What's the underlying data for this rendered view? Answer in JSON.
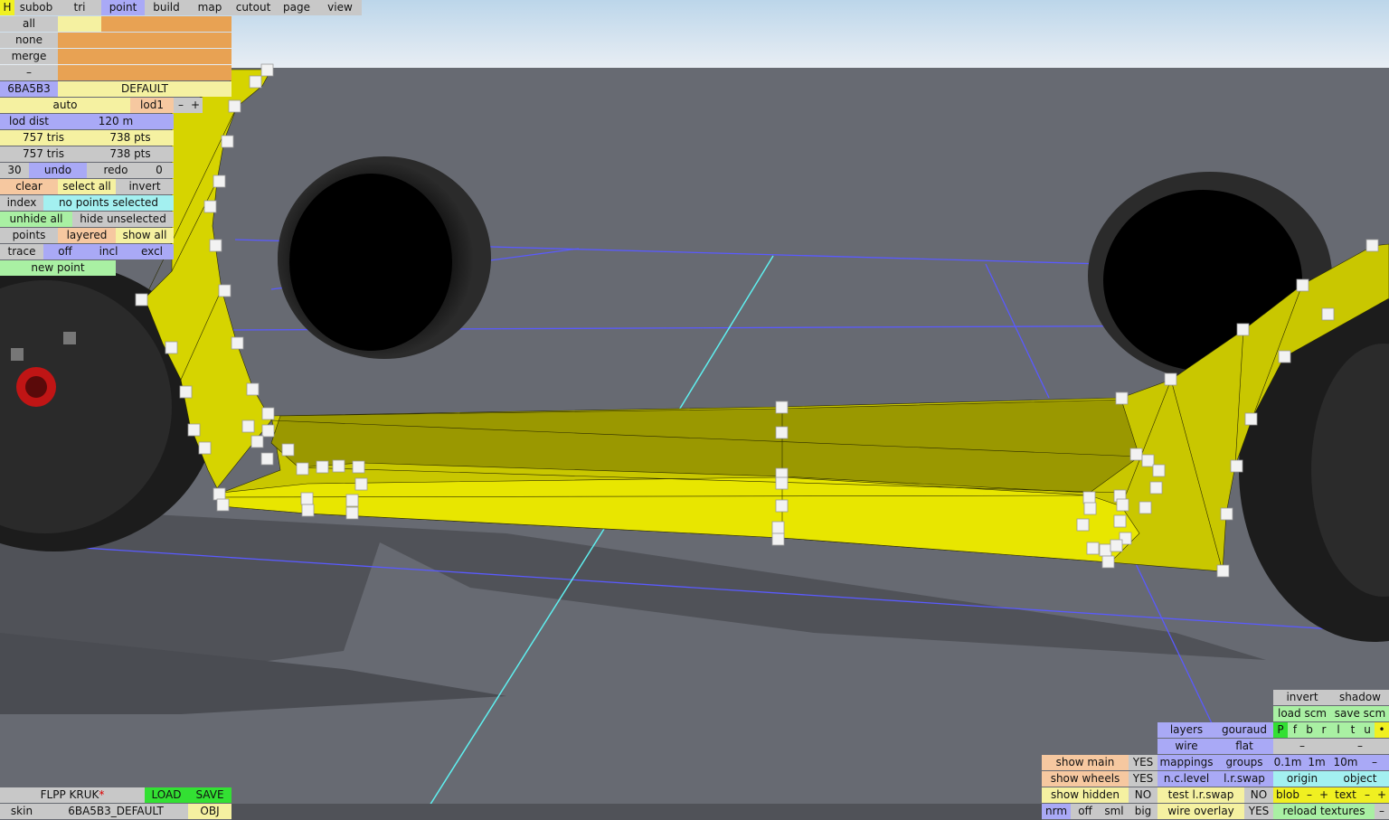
{
  "mode_tabs": [
    {
      "label": "H"
    },
    {
      "label": "subob"
    },
    {
      "label": "tri"
    },
    {
      "label": "point",
      "active": true
    },
    {
      "label": "build"
    },
    {
      "label": "map"
    },
    {
      "label": "cutout"
    },
    {
      "label": "page"
    },
    {
      "label": "view"
    }
  ],
  "selection": {
    "all": "all",
    "none": "none",
    "merge": "merge",
    "dash": "–"
  },
  "object": {
    "id": "6BA5B3",
    "group": "DEFAULT"
  },
  "lod": {
    "auto": "auto",
    "current": "lod1",
    "minus": "–",
    "plus": "+",
    "dist_label": "lod dist",
    "dist_value": "120 m"
  },
  "stats": {
    "tris_total": "757 tris",
    "pts_total": "738 pts",
    "tris_visible": "757 tris",
    "pts_visible": "738 pts"
  },
  "history": {
    "count": "30",
    "undo": "undo",
    "redo": "redo",
    "redo_count": "0"
  },
  "actions": {
    "clear": "clear",
    "select_all": "select all",
    "invert": "invert"
  },
  "index": {
    "label": "index",
    "status": "no points selected"
  },
  "hide": {
    "unhide_all": "unhide all",
    "hide_unselected": "hide unselected"
  },
  "display": {
    "points": "points",
    "layered": "layered",
    "show_all": "show all"
  },
  "trace": {
    "label": "trace",
    "off": "off",
    "incl": "incl",
    "excl": "excl"
  },
  "new_point": "new point",
  "file": {
    "name": "FLPP KRUK",
    "modified_mark": "*",
    "load": "LOAD",
    "save": "SAVE",
    "skin_label": "skin",
    "skin_value": "6BA5B3_DEFAULT",
    "format": "OBJ"
  },
  "view_toggles": [
    {
      "label": "show main",
      "value": "YES"
    },
    {
      "label": "show wheels",
      "value": "YES"
    },
    {
      "label": "show hidden",
      "value": "NO"
    }
  ],
  "render": {
    "layers": "layers",
    "gouraud": "gouraud",
    "wire": "wire",
    "flat": "flat",
    "mappings": "mappings",
    "groups": "groups",
    "nc_level": "n.c.level",
    "lr_swap": "l.r.swap",
    "test_lr_swap": "test l.r.swap",
    "test_lr_swap_value": "NO",
    "wire_overlay": "wire overlay",
    "wire_overlay_value": "YES",
    "nrm": "nrm",
    "off": "off",
    "sml": "sml",
    "big": "big"
  },
  "scene_panel": {
    "invert": "invert",
    "shadow": "shadow",
    "load_scm": "load scm",
    "save_scm": "save scm",
    "letters": [
      "P",
      "f",
      "b",
      "r",
      "l",
      "t",
      "u",
      "•"
    ],
    "dash1": "–",
    "dash2": "–",
    "grid": [
      "0.1m",
      "1m",
      "10m",
      "–"
    ],
    "origin": "origin",
    "object": "object",
    "blob": "blob",
    "blob_minus": "–",
    "blob_plus": "+",
    "text": "text",
    "text_minus": "–",
    "text_plus": "+",
    "reload_textures": "reload textures",
    "last": "–"
  },
  "colors": {
    "mesh_yellow": "#e3e000",
    "grid_blue": "#5a5aff",
    "grid_cyan": "#5ff0f0",
    "ground": "#676a72"
  }
}
